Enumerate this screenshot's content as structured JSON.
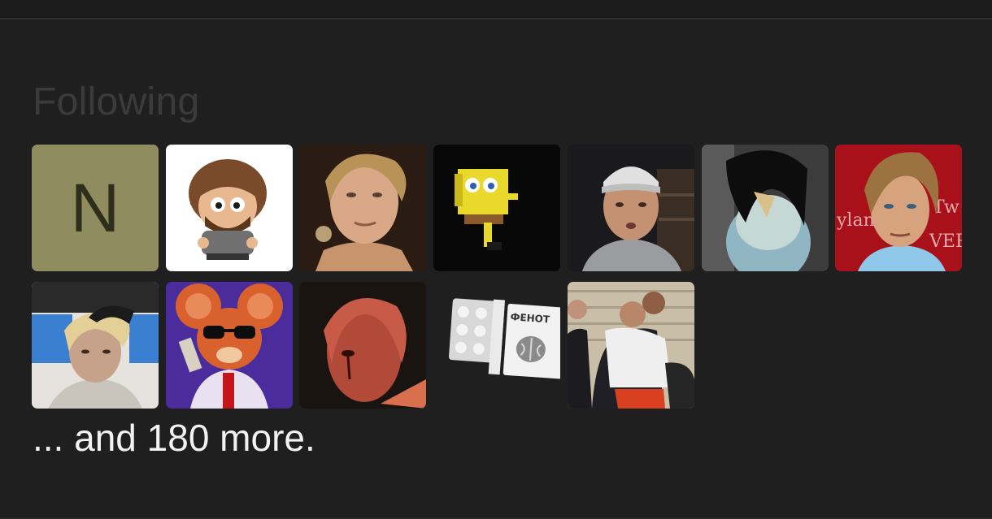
{
  "section": {
    "title": "Following"
  },
  "following": {
    "avatars": [
      {
        "name": "N",
        "kind": "letter",
        "color": "#8f8c5f"
      },
      {
        "name": "south-park-style-character",
        "kind": "image"
      },
      {
        "name": "blond-young-man",
        "kind": "image"
      },
      {
        "name": "yellow-sponge-cartoon",
        "kind": "image"
      },
      {
        "name": "man-in-cap",
        "kind": "image"
      },
      {
        "name": "parrot-with-black-hair",
        "kind": "image"
      },
      {
        "name": "man-on-red-background",
        "kind": "image"
      },
      {
        "name": "man-in-car",
        "kind": "image"
      },
      {
        "name": "mouse-with-sunglasses",
        "kind": "image"
      },
      {
        "name": "red-painted-face",
        "kind": "image"
      },
      {
        "name": "pill-blister-pack",
        "kind": "image",
        "text": "ФЕНОТ"
      },
      {
        "name": "man-being-escorted",
        "kind": "image"
      }
    ],
    "more_text": "... and 180 more."
  },
  "colors": {
    "background": "#1f1f1f",
    "title": "#3b3b3b",
    "text": "#f2f2f2"
  }
}
